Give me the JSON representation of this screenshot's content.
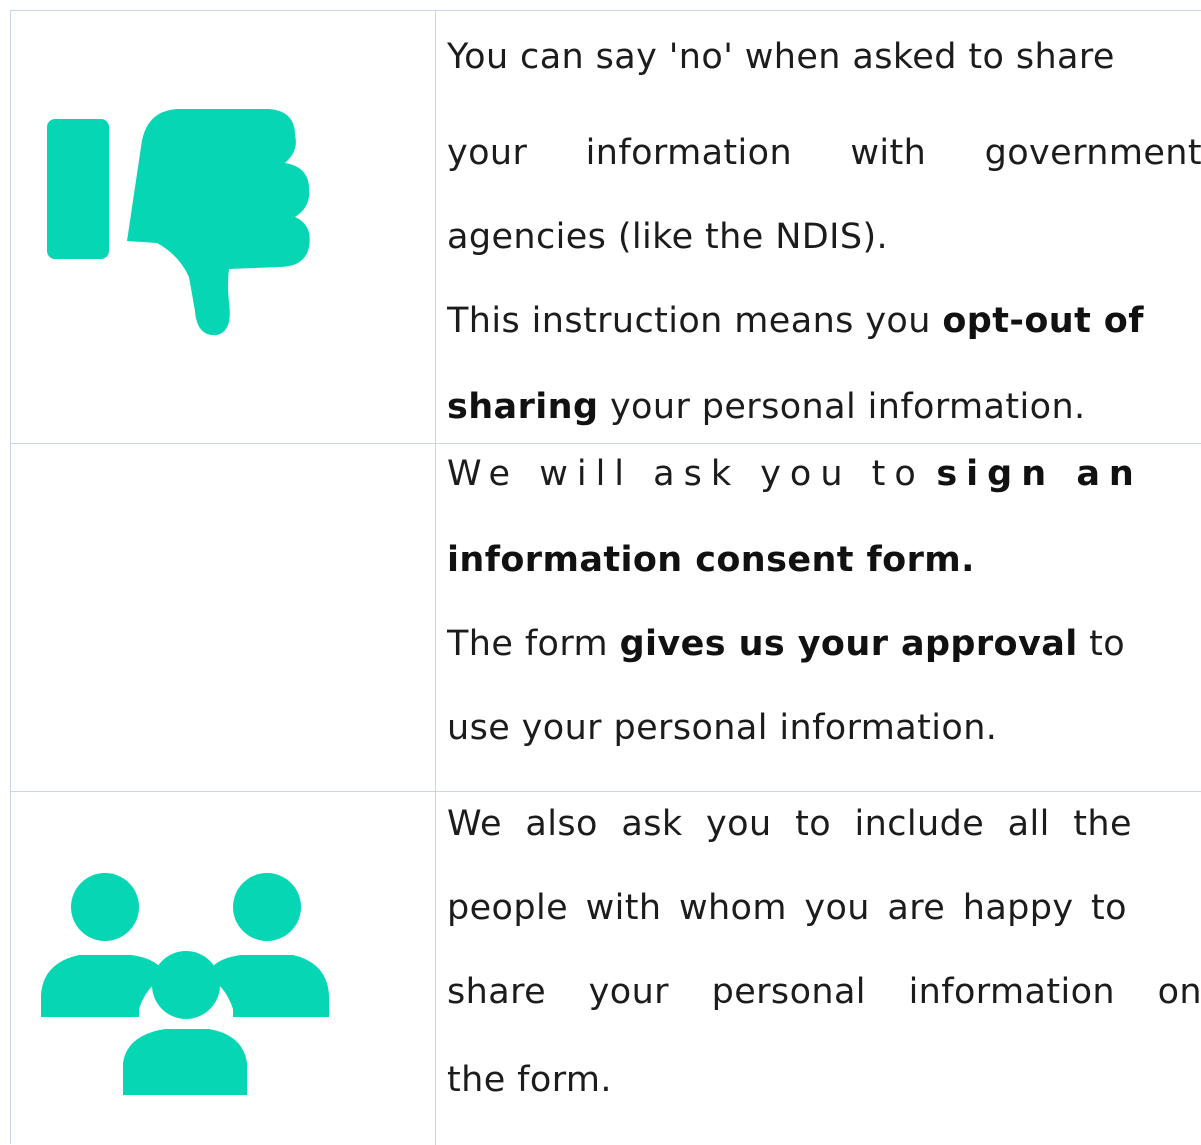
{
  "colors": {
    "accent": "#06d6b3",
    "border": "#c9d6e4",
    "text": "#1c1c1c"
  },
  "rows": [
    {
      "icon": "thumbs-down-icon",
      "lines": [
        [
          "You can say 'no' when asked to share"
        ],
        [
          "your",
          "information",
          "with",
          "government"
        ],
        [
          "agencies (like the NDIS)."
        ],
        [
          "This instruction means you",
          "opt-out of"
        ],
        [
          "sharing",
          "your personal information."
        ]
      ]
    },
    {
      "icon": "",
      "lines": [
        [
          "We will ask you to",
          "sign an"
        ],
        [
          "information consent form."
        ],
        [
          "The form",
          "gives us your approval",
          "to"
        ],
        [
          "use your personal information."
        ]
      ]
    },
    {
      "icon": "group-icon",
      "lines": [
        [
          "We also ask you to include all the"
        ],
        [
          "people with whom you are happy to"
        ],
        [
          "share",
          "your",
          "personal",
          "information",
          "on"
        ],
        [
          "the form."
        ]
      ]
    }
  ]
}
